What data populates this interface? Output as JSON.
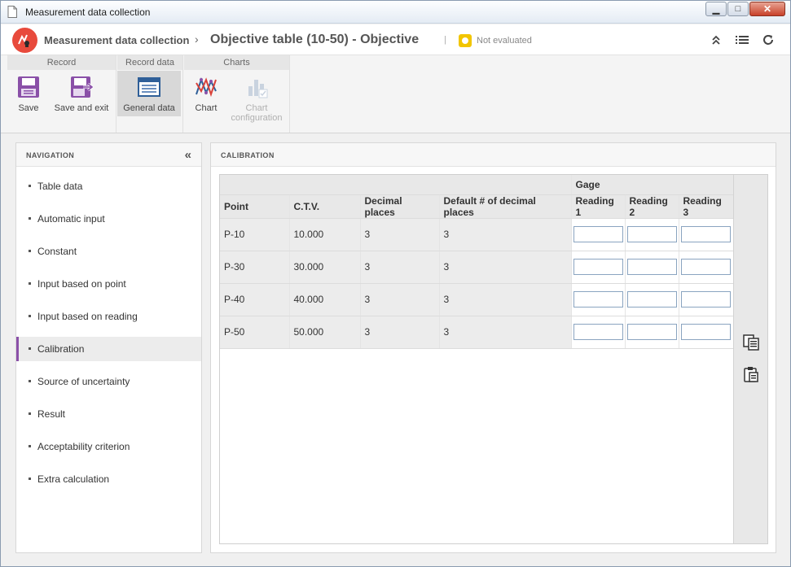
{
  "window": {
    "title": "Measurement data collection"
  },
  "header": {
    "app_name": "Measurement data collection",
    "separator": "›",
    "page_title": "Objective table (10-50) - Objective",
    "divider": "|",
    "status": "Not evaluated",
    "status_color": "#f2c500"
  },
  "ribbon": {
    "groups": [
      {
        "label": "Record"
      },
      {
        "label": "Record data"
      },
      {
        "label": "Charts"
      }
    ],
    "buttons": {
      "save": "Save",
      "save_exit": "Save and exit",
      "general_data": "General data",
      "chart": "Chart",
      "chart_config_line1": "Chart",
      "chart_config_line2": "configuration"
    }
  },
  "navigation": {
    "title": "NAVIGATION",
    "items": [
      {
        "label": "Table data"
      },
      {
        "label": "Automatic input"
      },
      {
        "label": "Constant"
      },
      {
        "label": "Input based on point"
      },
      {
        "label": "Input based on reading"
      },
      {
        "label": "Calibration"
      },
      {
        "label": "Source of uncertainty"
      },
      {
        "label": "Result"
      },
      {
        "label": "Acceptability criterion"
      },
      {
        "label": "Extra calculation"
      }
    ],
    "active_item": "Calibration"
  },
  "main": {
    "title": "CALIBRATION",
    "group_header": "Gage",
    "columns": [
      "Point",
      "C.T.V.",
      "Decimal places",
      "Default # of decimal places",
      "Reading 1",
      "Reading 2",
      "Reading 3"
    ],
    "rows": [
      {
        "point": "P-10",
        "ctv": "10.000",
        "decimals": "3",
        "default_decimals": "3",
        "readings": [
          "",
          "",
          ""
        ]
      },
      {
        "point": "P-30",
        "ctv": "30.000",
        "decimals": "3",
        "default_decimals": "3",
        "readings": [
          "",
          "",
          ""
        ]
      },
      {
        "point": "P-40",
        "ctv": "40.000",
        "decimals": "3",
        "default_decimals": "3",
        "readings": [
          "",
          "",
          ""
        ]
      },
      {
        "point": "P-50",
        "ctv": "50.000",
        "decimals": "3",
        "default_decimals": "3",
        "readings": [
          "",
          "",
          ""
        ]
      }
    ]
  },
  "icons": {
    "app": "measurement-logo-icon",
    "header": [
      "collapse-up-icon",
      "list-icon",
      "refresh-icon"
    ],
    "side_tools": [
      "copy-icon",
      "paste-icon"
    ]
  },
  "colors": {
    "accent": "#8a50a8",
    "logo": "#e84a3c",
    "input_border": "#8aa4c0"
  }
}
